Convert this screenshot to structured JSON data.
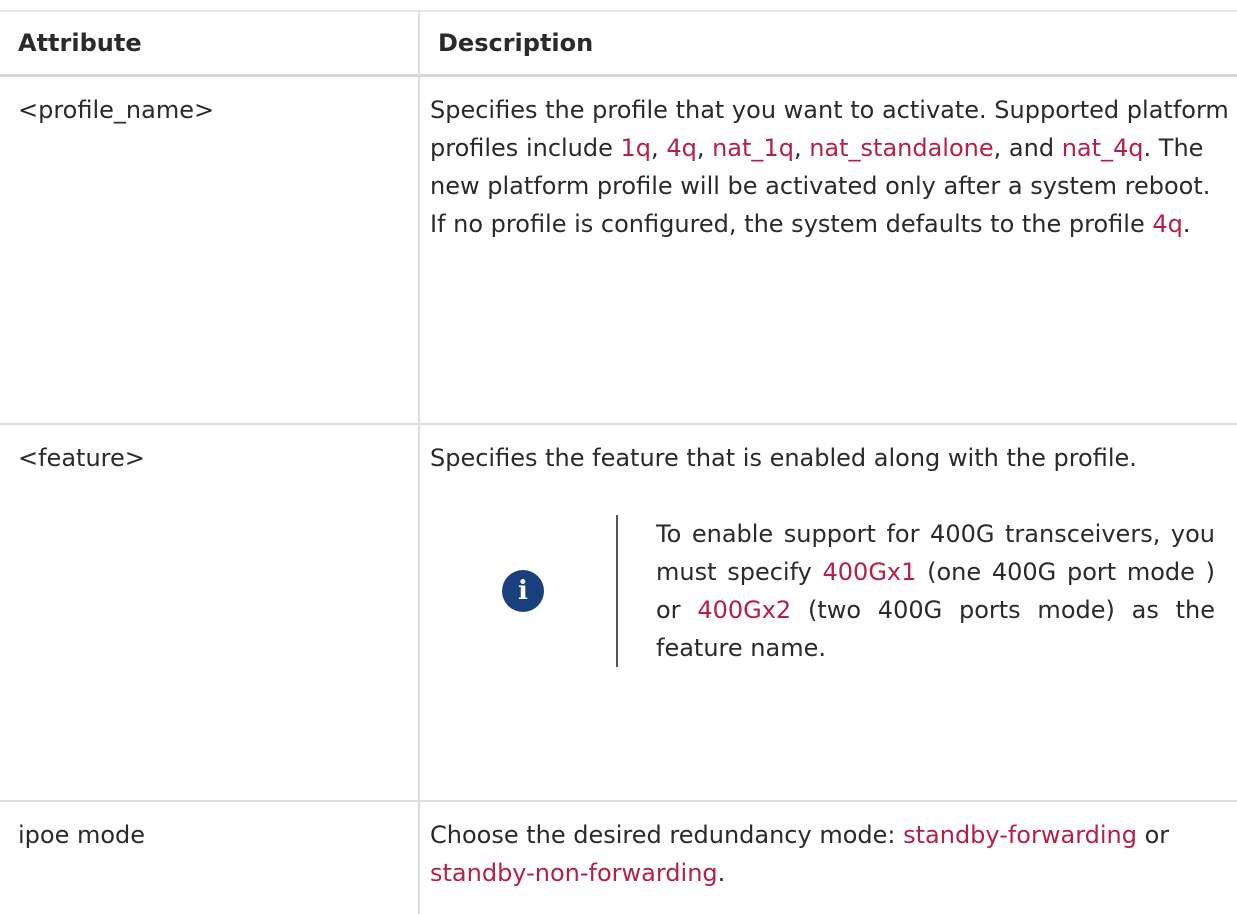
{
  "header": {
    "attribute": "Attribute",
    "description": "Description"
  },
  "rows": [
    {
      "attribute": "<profile_name>",
      "desc": {
        "p1": "Specifies the profile that you want to activate. Supported platform profiles include ",
        "c1": "1q",
        "p2": ", ",
        "c2": "4q",
        "p3": ", ",
        "c3": "nat_1q",
        "p4": ", ",
        "c4": "nat_standalone",
        "p5": ", and ",
        "c5": "nat_4q",
        "p6": ". The new platform profile will be activated only after a system reboot. If no profile is configured, the system defaults to the profile ",
        "c6": "4q",
        "p7": "."
      }
    },
    {
      "attribute": "<feature>",
      "desc": {
        "text": "Specifies the feature that is enabled along with the profile."
      },
      "note": {
        "icon": "info-icon",
        "p1": "To enable support for 400G transceivers, you must specify ",
        "c1": "400Gx1",
        "p2": " (one 400G port mode ) or ",
        "c2": "400Gx2",
        "p3": " (two 400G ports mode) as the feature name."
      }
    },
    {
      "attribute": "ipoe mode",
      "desc": {
        "p1": "Choose the desired redundancy mode: ",
        "c1": "standby-forwarding",
        "p2": " or ",
        "c2": "standby-non-forwarding",
        "p3": "."
      }
    }
  ],
  "colors": {
    "code": "#b5204a",
    "icon_bg": "#19407c",
    "border": "#dedede"
  }
}
